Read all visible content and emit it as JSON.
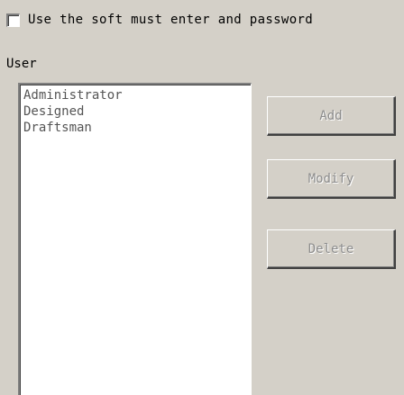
{
  "options": {
    "soft_password_label": "Use the soft must enter and password",
    "soft_password_checked": false
  },
  "users": {
    "group_label": "User",
    "items": [
      "Administrator",
      "Designed",
      "Draftsman"
    ]
  },
  "buttons": {
    "add_label": "Add",
    "modify_label": "Modify",
    "delete_label": "Delete"
  }
}
